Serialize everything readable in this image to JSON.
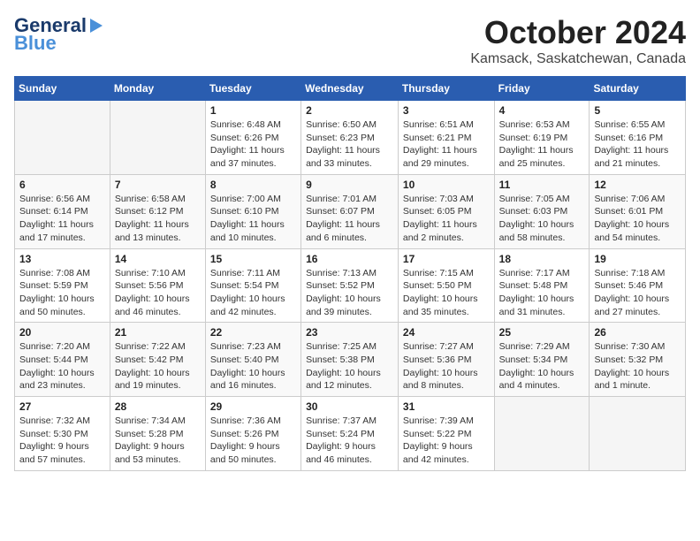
{
  "logo": {
    "line1": "General",
    "line2": "Blue",
    "icon": "▶"
  },
  "title": "October 2024",
  "location": "Kamsack, Saskatchewan, Canada",
  "days_of_week": [
    "Sunday",
    "Monday",
    "Tuesday",
    "Wednesday",
    "Thursday",
    "Friday",
    "Saturday"
  ],
  "weeks": [
    [
      {
        "day": "",
        "sunrise": "",
        "sunset": "",
        "daylight": ""
      },
      {
        "day": "",
        "sunrise": "",
        "sunset": "",
        "daylight": ""
      },
      {
        "day": "1",
        "sunrise": "Sunrise: 6:48 AM",
        "sunset": "Sunset: 6:26 PM",
        "daylight": "Daylight: 11 hours and 37 minutes."
      },
      {
        "day": "2",
        "sunrise": "Sunrise: 6:50 AM",
        "sunset": "Sunset: 6:23 PM",
        "daylight": "Daylight: 11 hours and 33 minutes."
      },
      {
        "day": "3",
        "sunrise": "Sunrise: 6:51 AM",
        "sunset": "Sunset: 6:21 PM",
        "daylight": "Daylight: 11 hours and 29 minutes."
      },
      {
        "day": "4",
        "sunrise": "Sunrise: 6:53 AM",
        "sunset": "Sunset: 6:19 PM",
        "daylight": "Daylight: 11 hours and 25 minutes."
      },
      {
        "day": "5",
        "sunrise": "Sunrise: 6:55 AM",
        "sunset": "Sunset: 6:16 PM",
        "daylight": "Daylight: 11 hours and 21 minutes."
      }
    ],
    [
      {
        "day": "6",
        "sunrise": "Sunrise: 6:56 AM",
        "sunset": "Sunset: 6:14 PM",
        "daylight": "Daylight: 11 hours and 17 minutes."
      },
      {
        "day": "7",
        "sunrise": "Sunrise: 6:58 AM",
        "sunset": "Sunset: 6:12 PM",
        "daylight": "Daylight: 11 hours and 13 minutes."
      },
      {
        "day": "8",
        "sunrise": "Sunrise: 7:00 AM",
        "sunset": "Sunset: 6:10 PM",
        "daylight": "Daylight: 11 hours and 10 minutes."
      },
      {
        "day": "9",
        "sunrise": "Sunrise: 7:01 AM",
        "sunset": "Sunset: 6:07 PM",
        "daylight": "Daylight: 11 hours and 6 minutes."
      },
      {
        "day": "10",
        "sunrise": "Sunrise: 7:03 AM",
        "sunset": "Sunset: 6:05 PM",
        "daylight": "Daylight: 11 hours and 2 minutes."
      },
      {
        "day": "11",
        "sunrise": "Sunrise: 7:05 AM",
        "sunset": "Sunset: 6:03 PM",
        "daylight": "Daylight: 10 hours and 58 minutes."
      },
      {
        "day": "12",
        "sunrise": "Sunrise: 7:06 AM",
        "sunset": "Sunset: 6:01 PM",
        "daylight": "Daylight: 10 hours and 54 minutes."
      }
    ],
    [
      {
        "day": "13",
        "sunrise": "Sunrise: 7:08 AM",
        "sunset": "Sunset: 5:59 PM",
        "daylight": "Daylight: 10 hours and 50 minutes."
      },
      {
        "day": "14",
        "sunrise": "Sunrise: 7:10 AM",
        "sunset": "Sunset: 5:56 PM",
        "daylight": "Daylight: 10 hours and 46 minutes."
      },
      {
        "day": "15",
        "sunrise": "Sunrise: 7:11 AM",
        "sunset": "Sunset: 5:54 PM",
        "daylight": "Daylight: 10 hours and 42 minutes."
      },
      {
        "day": "16",
        "sunrise": "Sunrise: 7:13 AM",
        "sunset": "Sunset: 5:52 PM",
        "daylight": "Daylight: 10 hours and 39 minutes."
      },
      {
        "day": "17",
        "sunrise": "Sunrise: 7:15 AM",
        "sunset": "Sunset: 5:50 PM",
        "daylight": "Daylight: 10 hours and 35 minutes."
      },
      {
        "day": "18",
        "sunrise": "Sunrise: 7:17 AM",
        "sunset": "Sunset: 5:48 PM",
        "daylight": "Daylight: 10 hours and 31 minutes."
      },
      {
        "day": "19",
        "sunrise": "Sunrise: 7:18 AM",
        "sunset": "Sunset: 5:46 PM",
        "daylight": "Daylight: 10 hours and 27 minutes."
      }
    ],
    [
      {
        "day": "20",
        "sunrise": "Sunrise: 7:20 AM",
        "sunset": "Sunset: 5:44 PM",
        "daylight": "Daylight: 10 hours and 23 minutes."
      },
      {
        "day": "21",
        "sunrise": "Sunrise: 7:22 AM",
        "sunset": "Sunset: 5:42 PM",
        "daylight": "Daylight: 10 hours and 19 minutes."
      },
      {
        "day": "22",
        "sunrise": "Sunrise: 7:23 AM",
        "sunset": "Sunset: 5:40 PM",
        "daylight": "Daylight: 10 hours and 16 minutes."
      },
      {
        "day": "23",
        "sunrise": "Sunrise: 7:25 AM",
        "sunset": "Sunset: 5:38 PM",
        "daylight": "Daylight: 10 hours and 12 minutes."
      },
      {
        "day": "24",
        "sunrise": "Sunrise: 7:27 AM",
        "sunset": "Sunset: 5:36 PM",
        "daylight": "Daylight: 10 hours and 8 minutes."
      },
      {
        "day": "25",
        "sunrise": "Sunrise: 7:29 AM",
        "sunset": "Sunset: 5:34 PM",
        "daylight": "Daylight: 10 hours and 4 minutes."
      },
      {
        "day": "26",
        "sunrise": "Sunrise: 7:30 AM",
        "sunset": "Sunset: 5:32 PM",
        "daylight": "Daylight: 10 hours and 1 minute."
      }
    ],
    [
      {
        "day": "27",
        "sunrise": "Sunrise: 7:32 AM",
        "sunset": "Sunset: 5:30 PM",
        "daylight": "Daylight: 9 hours and 57 minutes."
      },
      {
        "day": "28",
        "sunrise": "Sunrise: 7:34 AM",
        "sunset": "Sunset: 5:28 PM",
        "daylight": "Daylight: 9 hours and 53 minutes."
      },
      {
        "day": "29",
        "sunrise": "Sunrise: 7:36 AM",
        "sunset": "Sunset: 5:26 PM",
        "daylight": "Daylight: 9 hours and 50 minutes."
      },
      {
        "day": "30",
        "sunrise": "Sunrise: 7:37 AM",
        "sunset": "Sunset: 5:24 PM",
        "daylight": "Daylight: 9 hours and 46 minutes."
      },
      {
        "day": "31",
        "sunrise": "Sunrise: 7:39 AM",
        "sunset": "Sunset: 5:22 PM",
        "daylight": "Daylight: 9 hours and 42 minutes."
      },
      {
        "day": "",
        "sunrise": "",
        "sunset": "",
        "daylight": ""
      },
      {
        "day": "",
        "sunrise": "",
        "sunset": "",
        "daylight": ""
      }
    ]
  ]
}
